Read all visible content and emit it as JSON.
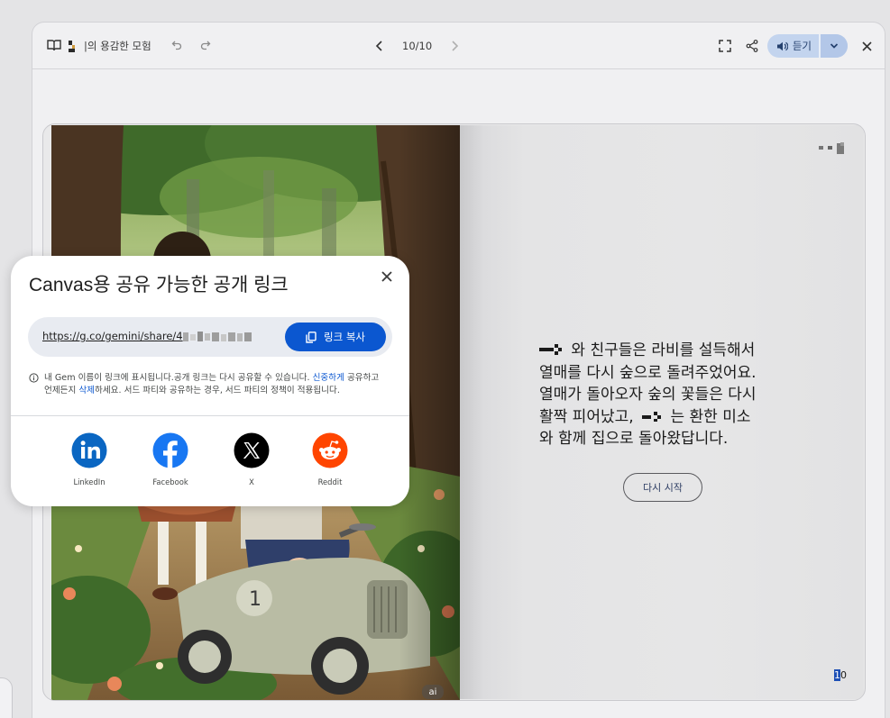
{
  "toolbar": {
    "title": "|의 용감한 모험",
    "page_indicator": "10/10",
    "listen_label": "듣기"
  },
  "story": {
    "text": "와 친구들은 라비를 설득해서 열매를 다시 숲으로 돌려주었어요. 열매가 돌아오자 숲의 꽃들은 다시 활짝 피어났고, 는 환한 미소와 함께 집으로 돌아왔답니다.",
    "line1": "와 친구들은 라비를 설득해서",
    "line2": "열매를 다시 숲으로 돌려주었어요.",
    "line3": "열매가 돌아오자 숲의 꽃들은 다시",
    "line4a": "활짝 피어났고,",
    "line4b": "는 환한 미소",
    "line5": "와 함께 집으로 돌아왔답니다.",
    "restart_label": "다시 시작",
    "page_number_selected": "1",
    "page_number_rest": "0",
    "ai_badge": "ai"
  },
  "share_dialog": {
    "title": "Canvas용 공유 가능한 공개 링크",
    "url": "https://g.co/gemini/share/4",
    "copy_label": "링크 복사",
    "notice_part1": "내 Gem 이름이 링크에 표시됩니다.공개 링크는 다시 공유할 수 있습니다. ",
    "notice_link1": "신중하게",
    "notice_part2": " 공유하고 언제든지 ",
    "notice_link2": "삭제",
    "notice_part3": "하세요. 서드 파티와 공유하는 경우, 서드 파티의 정책이 적용됩니다.",
    "socials": [
      {
        "label": "LinkedIn",
        "icon": "linkedin-icon",
        "color": "#0a66c2"
      },
      {
        "label": "Facebook",
        "icon": "facebook-icon",
        "color": "#1877f2"
      },
      {
        "label": "X",
        "icon": "x-icon",
        "color": "#000000"
      },
      {
        "label": "Reddit",
        "icon": "reddit-icon",
        "color": "#ff4500"
      }
    ]
  },
  "colors": {
    "primary_button": "#0b57d0",
    "listen_pill": "#c3d4ee"
  }
}
